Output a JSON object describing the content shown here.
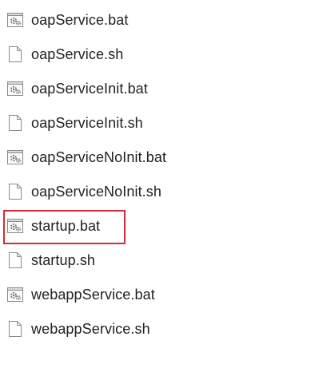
{
  "files": [
    {
      "name": "oapService.bat",
      "icon": "batch-file-icon"
    },
    {
      "name": "oapService.sh",
      "icon": "blank-file-icon"
    },
    {
      "name": "oapServiceInit.bat",
      "icon": "batch-file-icon"
    },
    {
      "name": "oapServiceInit.sh",
      "icon": "blank-file-icon"
    },
    {
      "name": "oapServiceNoInit.bat",
      "icon": "batch-file-icon"
    },
    {
      "name": "oapServiceNoInit.sh",
      "icon": "blank-file-icon"
    },
    {
      "name": "startup.bat",
      "icon": "batch-file-icon"
    },
    {
      "name": "startup.sh",
      "icon": "blank-file-icon"
    },
    {
      "name": "webappService.bat",
      "icon": "batch-file-icon"
    },
    {
      "name": "webappService.sh",
      "icon": "blank-file-icon"
    }
  ],
  "highlighted_file": "startup.bat",
  "colors": {
    "highlight_border": "#d42d35",
    "text": "#222222"
  }
}
